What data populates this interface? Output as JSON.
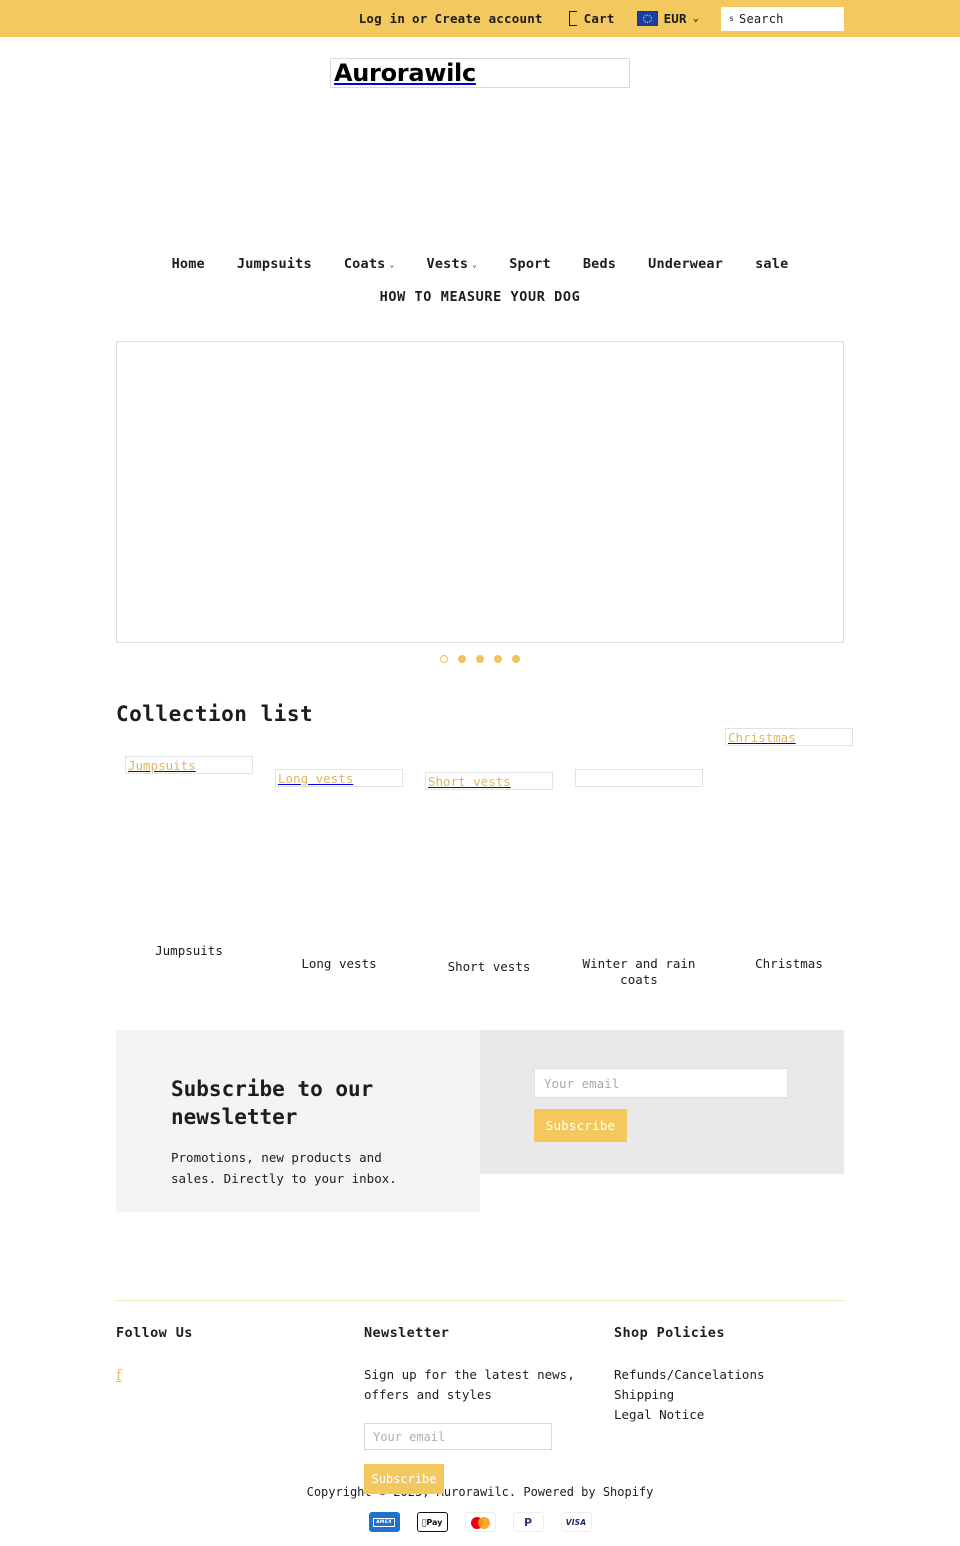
{
  "topbar": {
    "login_label": "Log in",
    "or_label": "or",
    "create_account_label": "Create account",
    "cart_label": "Cart",
    "cart_icon": "cart-icon",
    "currency_label": "EUR",
    "currency_flag": "eu-flag-icon",
    "currency_caret": "⌄",
    "search_glyph": "s",
    "search_placeholder": "Search",
    "bg_color": "#f3c85f"
  },
  "header": {
    "logo_text": "Aurorawilc"
  },
  "nav": {
    "items": [
      {
        "label": "Home",
        "caret": ""
      },
      {
        "label": "Jumpsuits",
        "caret": ""
      },
      {
        "label": "Coats",
        "caret": "⌄"
      },
      {
        "label": "Vests",
        "caret": "⌄"
      },
      {
        "label": "Sport",
        "caret": ""
      },
      {
        "label": "Beds",
        "caret": ""
      },
      {
        "label": "Underwear",
        "caret": ""
      },
      {
        "label": "sale",
        "caret": ""
      }
    ],
    "secondary": "HOW TO MEASURE YOUR DOG"
  },
  "hero": {
    "slide_alt": "",
    "dots": [
      {
        "active": true
      },
      {
        "active": false
      },
      {
        "active": false
      },
      {
        "active": false
      },
      {
        "active": false
      }
    ]
  },
  "collections": {
    "title": "Collection list",
    "items": [
      {
        "alt": "Jumpsuits",
        "label": "Jumpsuits"
      },
      {
        "alt": "Long vests",
        "label": "Long vests"
      },
      {
        "alt": "Short vests",
        "label": "Short vests"
      },
      {
        "alt": "",
        "label": "Winter and rain coats"
      },
      {
        "alt": "Christmas",
        "label": "Christmas"
      }
    ]
  },
  "newsletter_banner": {
    "title": "Subscribe to our newsletter",
    "subtitle": "Promotions, new products and sales. Directly to your inbox.",
    "email_placeholder": "Your email",
    "email_value": "",
    "subscribe_label": "Subscribe",
    "button_color": "#f3c85f"
  },
  "footer": {
    "follow": {
      "title": "Follow Us",
      "facebook_icon": "facebook-icon",
      "facebook_glyph": "f"
    },
    "newsletter": {
      "title": "Newsletter",
      "text": "Sign up for the latest news, offers and styles",
      "email_placeholder": "Your email",
      "email_value": "",
      "subscribe_label": "Subscribe"
    },
    "policies": {
      "title": "Shop Policies",
      "links": [
        "Refunds/Cancelations",
        "Shipping",
        "Legal Notice"
      ]
    },
    "copyright": "Copyright © 2023, Aurorawilc. Powered by Shopify",
    "payments": [
      {
        "name": "amex-icon",
        "label": "AMEX"
      },
      {
        "name": "apple-pay-icon",
        "label": "Pay"
      },
      {
        "name": "mastercard-icon",
        "label": ""
      },
      {
        "name": "paypal-icon",
        "label": "P"
      },
      {
        "name": "visa-icon",
        "label": "VISA"
      }
    ]
  }
}
